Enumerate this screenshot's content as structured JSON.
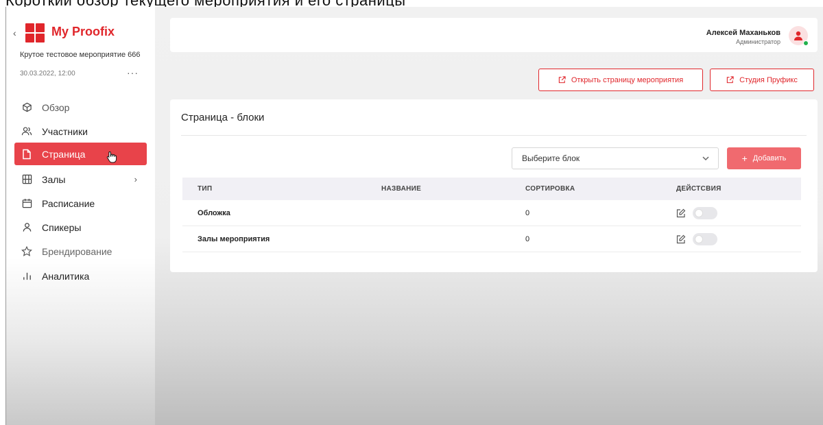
{
  "top_strip_text": "Короткий обзор текущего мероприятия и его страницы",
  "sidebar": {
    "brand": "My Proofix",
    "event_name": "Крутое тестовое мероприятие 666",
    "event_date": "30.03.2022, 12:00",
    "more": "···",
    "items": [
      {
        "label": "Обзор",
        "icon": "cube-icon"
      },
      {
        "label": "Участники",
        "icon": "users-icon"
      },
      {
        "label": "Страница",
        "icon": "page-icon",
        "active": true
      },
      {
        "label": "Залы",
        "icon": "grid-icon",
        "has_arrow": true
      },
      {
        "label": "Расписание",
        "icon": "calendar-icon"
      },
      {
        "label": "Спикеры",
        "icon": "user-icon"
      },
      {
        "label": "Брендирование",
        "icon": "star-icon"
      },
      {
        "label": "Аналитика",
        "icon": "bars-icon"
      }
    ]
  },
  "header": {
    "user_name": "Алексей Маханьков",
    "user_role": "Администратор",
    "status_color": "#22b14c"
  },
  "actions": {
    "open_event_page": "Открыть страницу мероприятия",
    "studio": "Студия Пруфикс"
  },
  "card": {
    "title": "Страница - блоки",
    "select_placeholder": "Выберите блок",
    "add_button": "Добавить",
    "columns": [
      "ТИП",
      "НАЗВАНИЕ",
      "СОРТИРОВКА",
      "ДЕЙСТСВИЯ"
    ],
    "rows": [
      {
        "type": "Обложка",
        "name": "",
        "sort": "0",
        "enabled": false
      },
      {
        "type": "Залы мероприятия",
        "name": "",
        "sort": "0",
        "enabled": false
      }
    ]
  },
  "colors": {
    "accent": "#e0262b",
    "active_nav": "#e8434a",
    "add_button": "#f06a6f"
  }
}
